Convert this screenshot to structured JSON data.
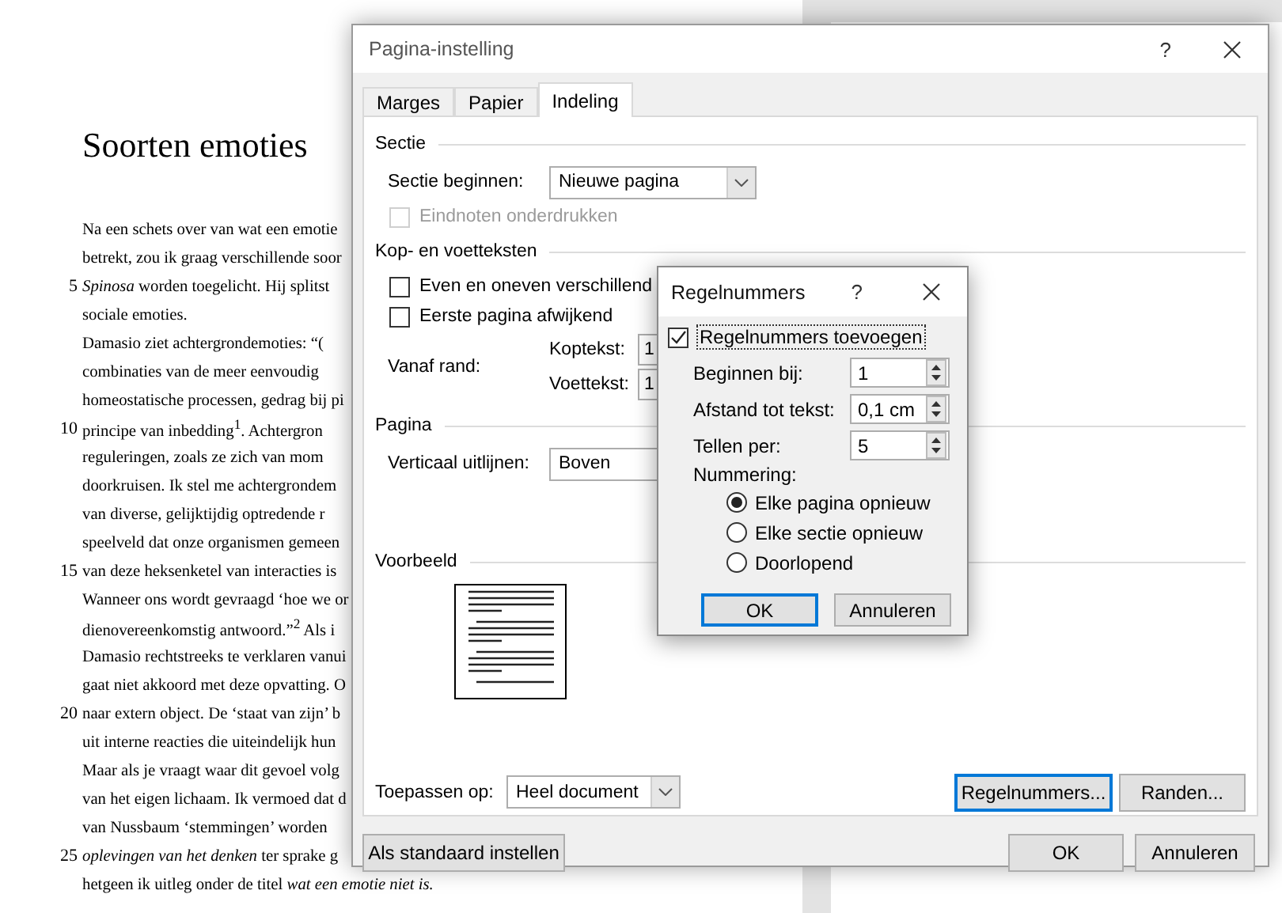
{
  "document": {
    "title": "Soorten emoties",
    "lines": [
      {
        "text": "Na een schets over van wat een emotie"
      },
      {
        "text": "betrekt, zou ik graag verschillende soor"
      },
      {
        "number": "5",
        "text": "*Spinosa* worden toegelicht. Hij splitst"
      },
      {
        "text": "sociale emoties."
      },
      {
        "text": "Damasio ziet achtergrondemoties: “("
      },
      {
        "text": "combinaties van de meer eenvoudig"
      },
      {
        "text": "homeostatische processen, gedrag bij pi"
      },
      {
        "number": "10",
        "text": "principe van inbedding$^{1}$. Achtergron"
      },
      {
        "text": "reguleringen, zoals ze zich van mom"
      },
      {
        "text": "doorkruisen. Ik stel me achtergrondem"
      },
      {
        "text": "van diverse, gelijktijdig optredende r"
      },
      {
        "text": "speelveld dat onze organismen gemeen"
      },
      {
        "number": "15",
        "text": "van deze heksenketel van interacties is"
      },
      {
        "text": "Wanneer ons wordt gevraagd ‘hoe we or"
      },
      {
        "text": "dienovereenkomstig antwoord.”$^{2}$ Als i"
      },
      {
        "text": "Damasio rechtstreeks te verklaren vanui"
      },
      {
        "text": "gaat niet akkoord met deze opvatting. O"
      },
      {
        "number": "20",
        "text": "naar extern object. De ‘staat van zijn’ b"
      },
      {
        "text": "uit interne reacties die uiteindelijk hun"
      },
      {
        "text": "Maar als je vraagt waar dit gevoel volg"
      },
      {
        "text": "van het eigen lichaam. Ik vermoed dat d"
      },
      {
        "text": "van Nussbaum ‘stemmingen’ worden"
      },
      {
        "number": "25",
        "text": "*oplevingen van het denken* ter sprake g"
      },
      {
        "text": "hetgeen ik uitleg onder de titel *wat een emotie niet is.*"
      }
    ]
  },
  "page_setup": {
    "title": "Pagina-instelling",
    "help": "?",
    "tabs": [
      {
        "label": "Marges",
        "selected": false
      },
      {
        "label": "Papier",
        "selected": false
      },
      {
        "label": "Indeling",
        "selected": true
      }
    ],
    "section": {
      "heading": "Sectie",
      "start_label": "Sectie beginnen:",
      "start_value": "Nieuwe pagina",
      "endnotes": {
        "label": "Eindnoten onderdrukken",
        "checked": false,
        "disabled": true
      }
    },
    "headers_footers": {
      "heading": "Kop- en voetteksten",
      "options": [
        {
          "label": "Even en oneven verschillend",
          "checked": false
        },
        {
          "label": "Eerste pagina afwijkend",
          "checked": false
        }
      ],
      "from_edge_label": "Vanaf rand:",
      "fields": [
        {
          "label": "Koptekst:",
          "value": "1"
        },
        {
          "label": "Voettekst:",
          "value": "1"
        }
      ]
    },
    "page": {
      "heading": "Pagina",
      "align_label": "Verticaal uitlijnen:",
      "align_value": "Boven"
    },
    "preview": {
      "heading": "Voorbeeld"
    },
    "apply_label": "Toepassen op:",
    "apply_value": "Heel document",
    "panel_buttons": [
      {
        "label": "Regelnummers...",
        "focused": true
      },
      {
        "label": "Randen...",
        "focused": false
      }
    ],
    "footer_buttons": [
      {
        "label": "Als standaard instellen",
        "focused": false
      },
      {
        "label": "OK",
        "focused": false
      },
      {
        "label": "Annuleren",
        "focused": false
      }
    ]
  },
  "line_numbers": {
    "title": "Regelnummers",
    "help": "?",
    "add": {
      "label": "Regelnummers toevoegen",
      "checked": true
    },
    "fields": [
      {
        "label": "Beginnen bij:",
        "value": "1"
      },
      {
        "label": "Afstand tot tekst:",
        "value": "0,1 cm"
      },
      {
        "label": "Tellen per:",
        "value": "5"
      }
    ],
    "numbering_label": "Nummering:",
    "options": [
      {
        "label": "Elke pagina opnieuw",
        "selected": true
      },
      {
        "label": "Elke sectie opnieuw",
        "selected": false
      },
      {
        "label": "Doorlopend",
        "selected": false
      }
    ],
    "buttons": [
      {
        "label": "OK",
        "focused": true
      },
      {
        "label": "Annuleren",
        "focused": false
      }
    ]
  }
}
